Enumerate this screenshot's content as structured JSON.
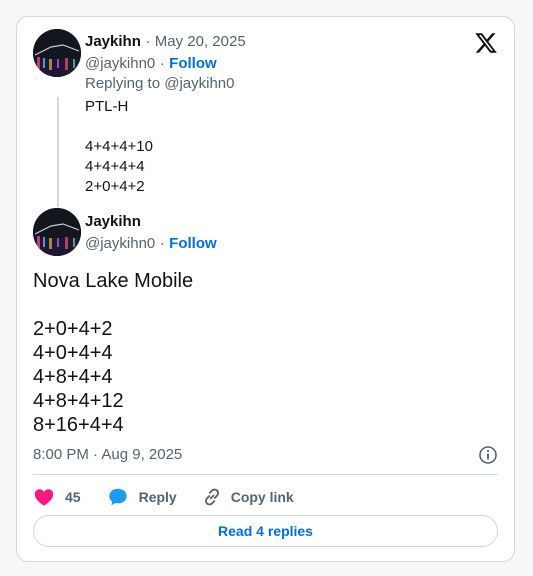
{
  "parent_tweet": {
    "display_name": "Jaykihn",
    "date_separator": "·",
    "date": "May 20, 2025",
    "handle": "@jaykihn0",
    "follow_separator": "·",
    "follow_label": "Follow",
    "replying_to": "Replying to @jaykihn0",
    "lines": [
      "PTL-H",
      "",
      "4+4+4+10",
      "4+4+4+4",
      "2+0+4+2"
    ]
  },
  "main_tweet": {
    "display_name": "Jaykihn",
    "handle": "@jaykihn0",
    "follow_separator": "·",
    "follow_label": "Follow",
    "lines": [
      "Nova Lake Mobile",
      "",
      "2+0+4+2",
      "4+0+4+4",
      "4+8+4+4",
      "4+8+4+12",
      "8+16+4+4"
    ],
    "timestamp": "8:00 PM · Aug 9, 2025"
  },
  "actions": {
    "like_count": "45",
    "reply_label": "Reply",
    "copy_link_label": "Copy link"
  },
  "read_replies_label": "Read 4 replies",
  "icons": {
    "brand": "x-logo-icon",
    "like": "heart-icon",
    "reply": "speech-bubble-icon",
    "copy": "link-icon",
    "info": "info-icon"
  },
  "colors": {
    "link_blue": "#006fd6",
    "like_pink": "#f91880",
    "reply_blue": "#1d9bf0",
    "muted_gray": "#536471",
    "border": "#cfd9de"
  }
}
